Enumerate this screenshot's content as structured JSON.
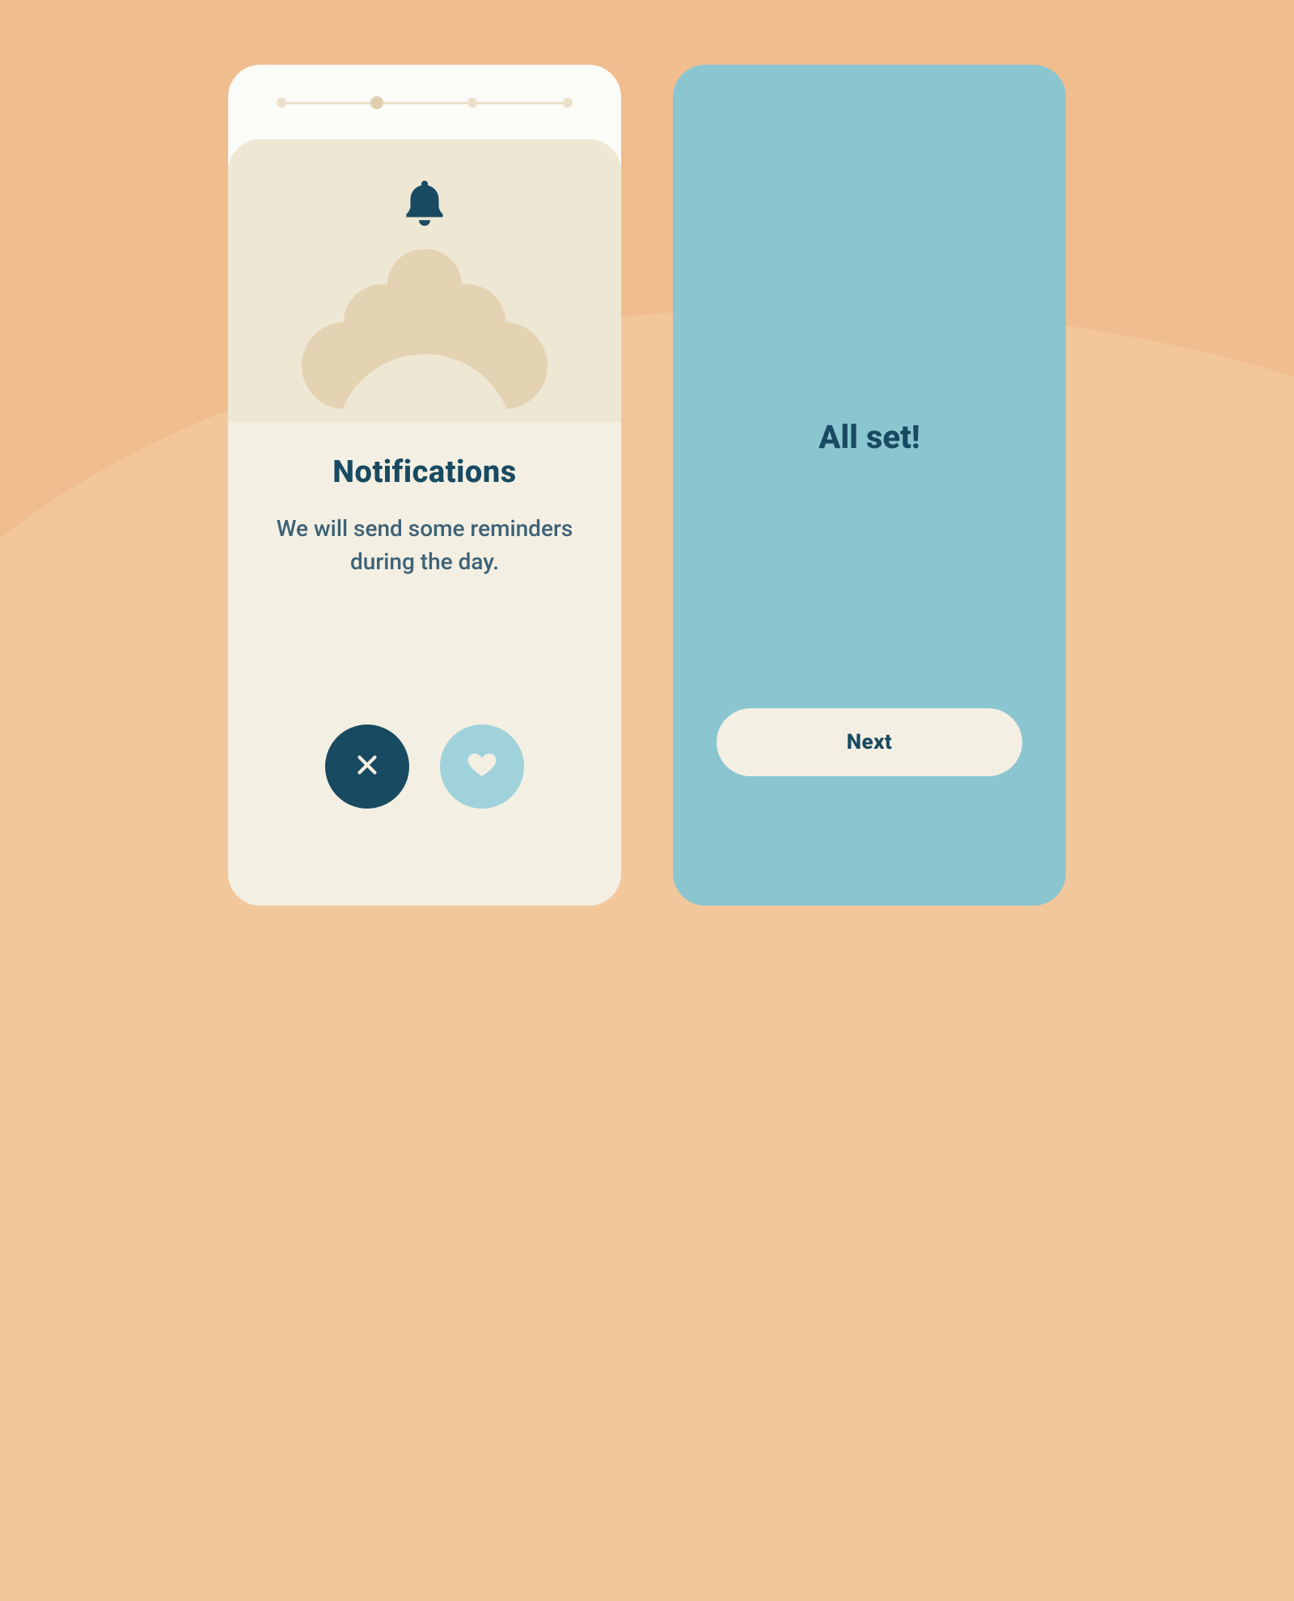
{
  "colors": {
    "background": "#f0bd8e",
    "backgroundLight": "#f3c79c",
    "card": "#f3efe2",
    "hero": "#eee7d4",
    "accentDark": "#184a61",
    "accentLight": "#9fd2db",
    "pale": "#e3d3b3"
  },
  "left": {
    "progress": {
      "total": 4,
      "activeIndex": 1
    },
    "heroIcon": "bell-icon",
    "title": "Notifications",
    "subtitle": "We will send some reminders during the day.",
    "actions": {
      "reject": {
        "icon": "close-icon"
      },
      "accept": {
        "icon": "heart-icon"
      }
    }
  },
  "right": {
    "title": "All set!",
    "button": "Next"
  }
}
